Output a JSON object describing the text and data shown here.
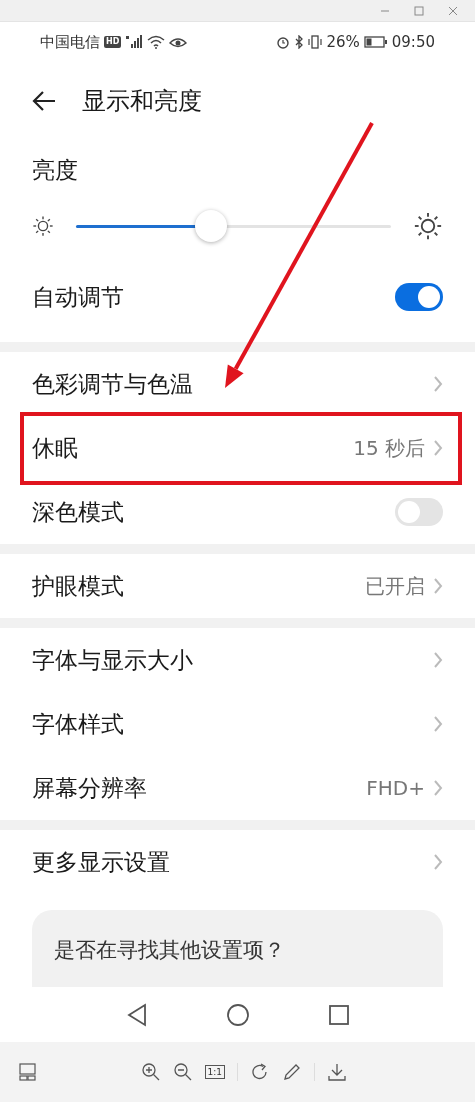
{
  "status_bar": {
    "carrier": "中国电信",
    "hd_badge": "HD",
    "battery": "26%",
    "time": "09:50"
  },
  "header": {
    "title": "显示和亮度"
  },
  "brightness": {
    "label": "亮度",
    "level": 0.43
  },
  "auto_adjust": {
    "label": "自动调节",
    "on": true
  },
  "groups": [
    {
      "rows": [
        {
          "kind": "link",
          "label": "色彩调节与色温",
          "highlighted": false
        },
        {
          "kind": "link",
          "label": "休眠",
          "value": "15 秒后",
          "highlighted": true
        },
        {
          "kind": "toggle",
          "label": "深色模式",
          "on": false,
          "highlighted": false
        }
      ]
    },
    {
      "rows": [
        {
          "kind": "link",
          "label": "护眼模式",
          "value": "已开启",
          "highlighted": false
        }
      ]
    },
    {
      "rows": [
        {
          "kind": "link",
          "label": "字体与显示大小",
          "highlighted": false
        },
        {
          "kind": "link",
          "label": "字体样式",
          "highlighted": false
        },
        {
          "kind": "link",
          "label": "屏幕分辨率",
          "value": "FHD+",
          "highlighted": false
        }
      ]
    },
    {
      "rows": [
        {
          "kind": "link",
          "label": "更多显示设置",
          "highlighted": false
        }
      ]
    }
  ],
  "suggestion_card": {
    "prompt": "是否在寻找其他设置项？"
  },
  "viewer_toolbar": {
    "actual_size_label": "1:1"
  }
}
